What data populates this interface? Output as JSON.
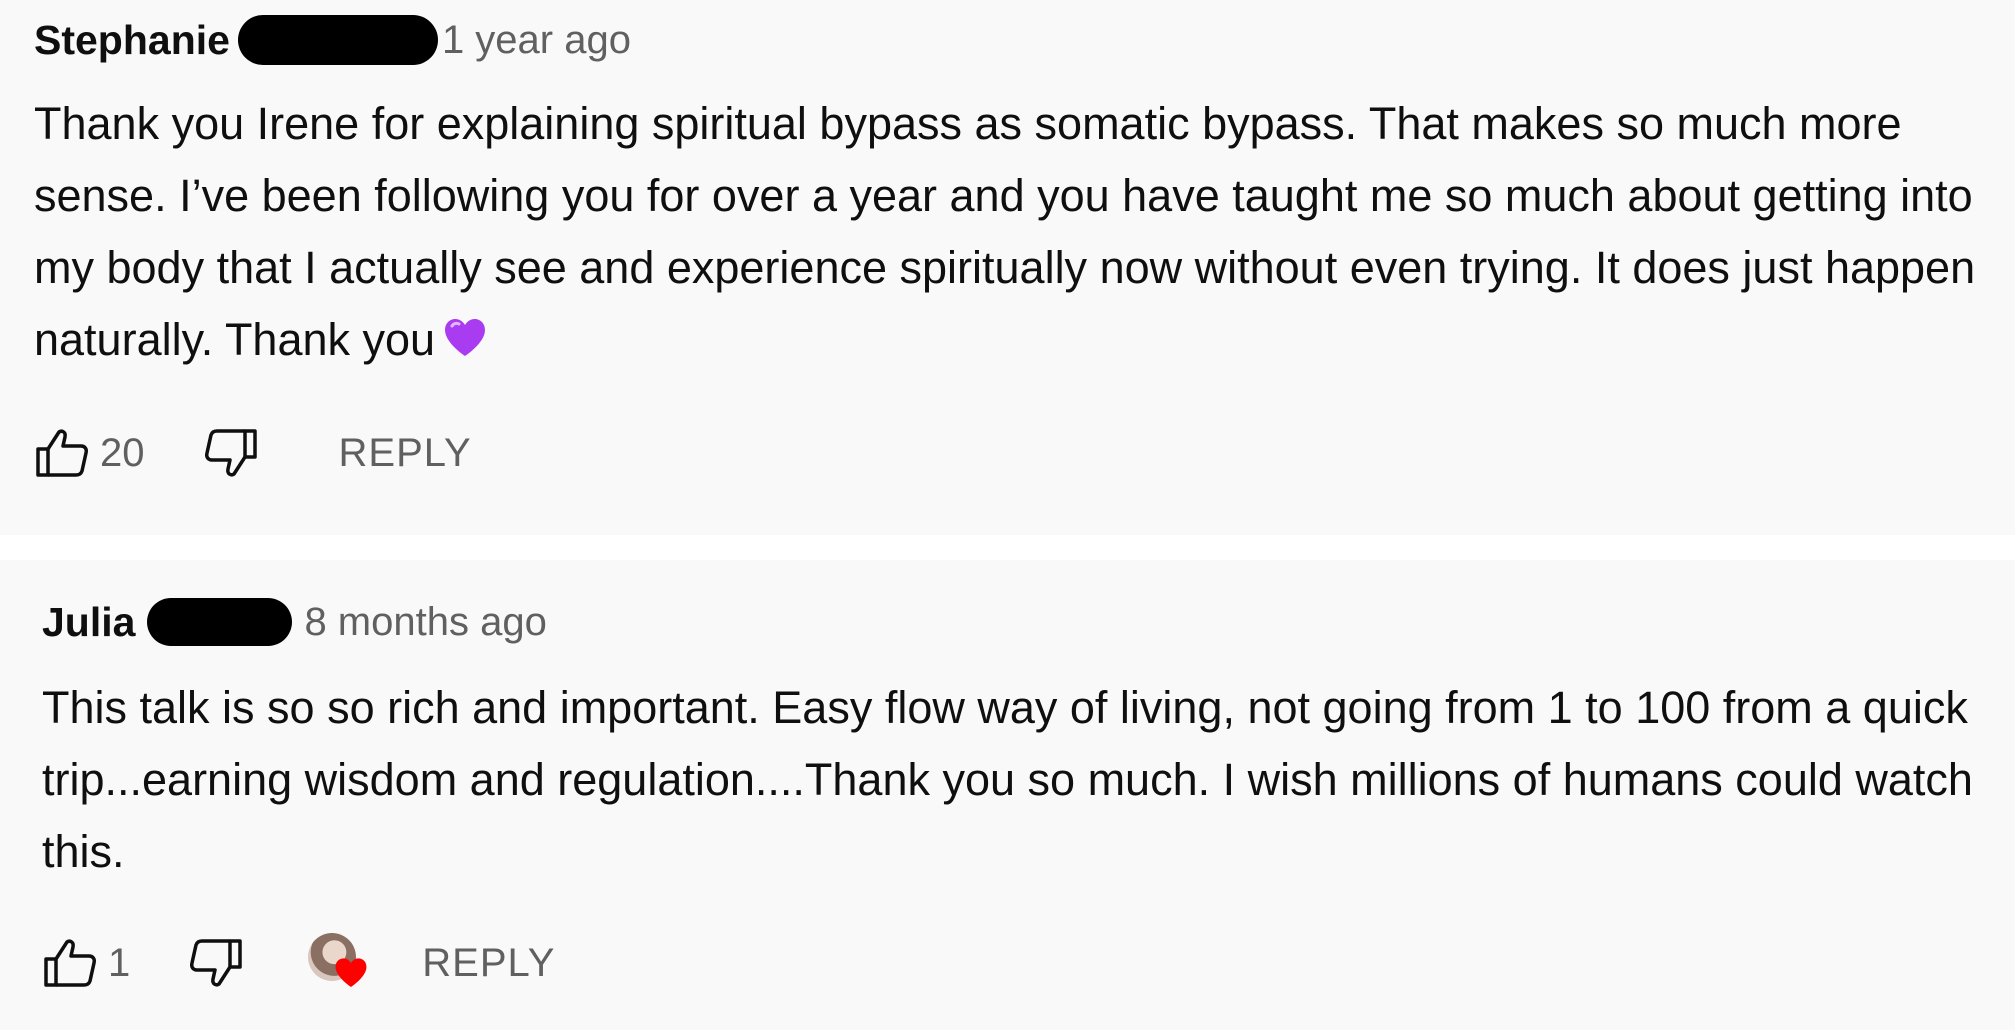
{
  "comments": [
    {
      "author": "Stephanie",
      "timestamp": "1 year ago",
      "text": "Thank you Irene for explaining spiritual bypass as somatic bypass. That makes so much more sense. I’ve been following you for over a year and you have taught me so much about getting into my body that I actually see and experience spiritually now without even trying. It does just happen naturally. Thank you",
      "emoji": "purple-heart",
      "like_count": "20",
      "reply_label": "REPLY",
      "creator_heart": false
    },
    {
      "author": "Julia",
      "timestamp": "8 months ago",
      "text": "This talk is so so rich and important. Easy flow way of living, not going from 1 to 100 from a quick trip...earning wisdom and regulation....Thank you so much. I wish millions of humans could watch this.",
      "like_count": "1",
      "reply_label": "REPLY",
      "creator_heart": true
    }
  ],
  "colors": {
    "background": "#f9f9f9",
    "separator": "#ffffff",
    "text": "#0f0f0f",
    "secondary_text": "#606060",
    "purple_heart": "#a93cf0",
    "red_heart": "#ff0000"
  },
  "icons": {
    "like": "thumbs-up-icon",
    "dislike": "thumbs-down-icon",
    "creator_heart": "heart-icon"
  }
}
